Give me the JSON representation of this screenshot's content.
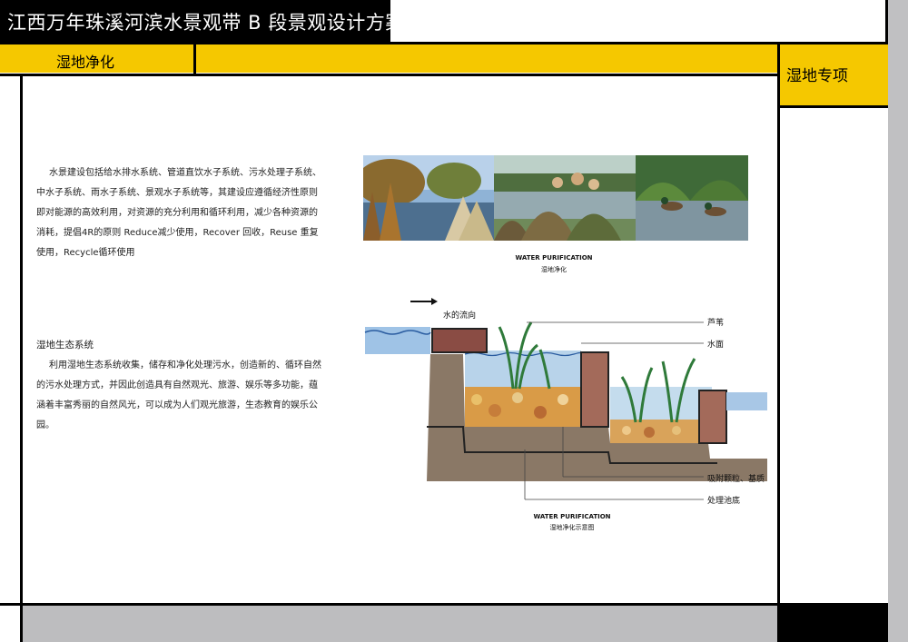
{
  "header": {
    "title": "江西万年珠溪河滨水景观带 B 段景观设计方案"
  },
  "section": {
    "title": "湿地净化"
  },
  "side": {
    "title": "湿地专项"
  },
  "body": {
    "paragraph1": "水景建设包括给水排水系统、管道直饮水子系统、污水处理子系统、中水子系统、雨水子系统、景观水子系统等，其建设应遵循经济性原则即对能源的高效利用，对资源的充分利用和循环利用，减少各种资源的消耗，提倡4R的原则 Reduce减少使用，Recover 回收，Reuse 重复使用，Recycle循环使用",
    "subheading": "湿地生态系统",
    "paragraph2": "利用湿地生态系统收集，储存和净化处理污水，创造新的、循环自然的污水处理方式，并因此创造具有自然观光、旅游、娱乐等多功能，蕴涵着丰富秀丽的自然风光，可以成为人们观光旅游，生态教育的娱乐公园。"
  },
  "figure_photos": {
    "caption_en": "WATER PURIFICATION",
    "caption_cn": "湿地净化"
  },
  "figure_diagram": {
    "flow_label": "水的流向",
    "labels": {
      "reed": "芦苇",
      "water_surface": "水面",
      "substrate": "吸附颗粒、基质",
      "tank_bottom": "处理池底"
    },
    "caption_en": "WATER PURIFICATION",
    "caption_cn": "湿地净化示意图"
  },
  "colors": {
    "accent_yellow": "#f5c800",
    "frame_black": "#000000",
    "side_grey": "#c0c0c2"
  }
}
